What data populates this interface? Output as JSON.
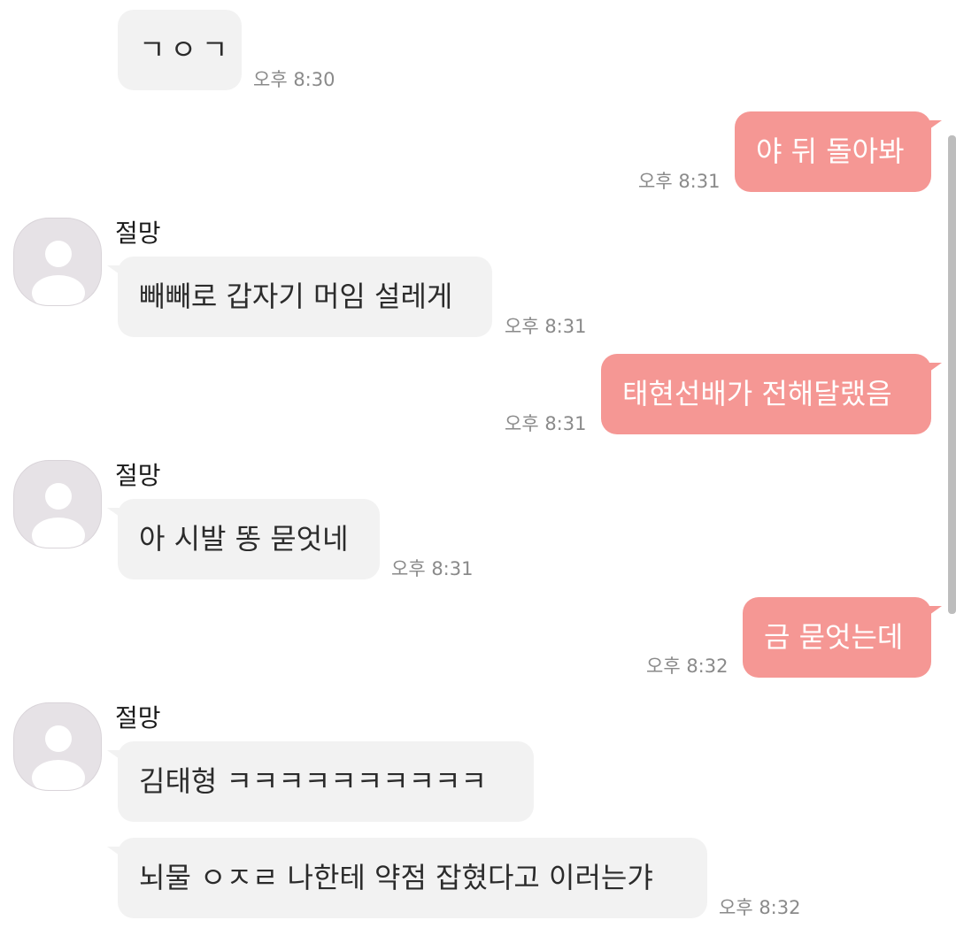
{
  "conversation": {
    "contact_name": "절망",
    "colors": {
      "incoming_bubble": "#f2f2f2",
      "outgoing_bubble": "#f59794",
      "timestamp": "#8a8a8a"
    },
    "messages": [
      {
        "direction": "in",
        "text": "ㄱㅇㄱ",
        "time": "오후 8:30"
      },
      {
        "direction": "out",
        "text": "야 뒤 돌아봐",
        "time": "오후 8:31"
      },
      {
        "direction": "in",
        "sender": "절망",
        "text": "빼빼로 갑자기 머임 설레게",
        "time": "오후 8:31"
      },
      {
        "direction": "out",
        "text": "태현선배가 전해달랬음",
        "time": "오후 8:31"
      },
      {
        "direction": "in",
        "sender": "절망",
        "text": "아 시발 똥 묻엇네",
        "time": "오후 8:31"
      },
      {
        "direction": "out",
        "text": "금 묻엇는데",
        "time": "오후 8:32"
      },
      {
        "direction": "in",
        "sender": "절망",
        "text": "김태형 ㅋㅋㅋㅋㅋㅋㅋㅋㅋㅋ"
      },
      {
        "direction": "in",
        "text": "뇌물 ㅇㅈㄹ 나한테 약점 잡혔다고 이러는갸",
        "time": "오후 8:32"
      }
    ]
  },
  "icons": {
    "avatar": "default-person-avatar-icon"
  }
}
